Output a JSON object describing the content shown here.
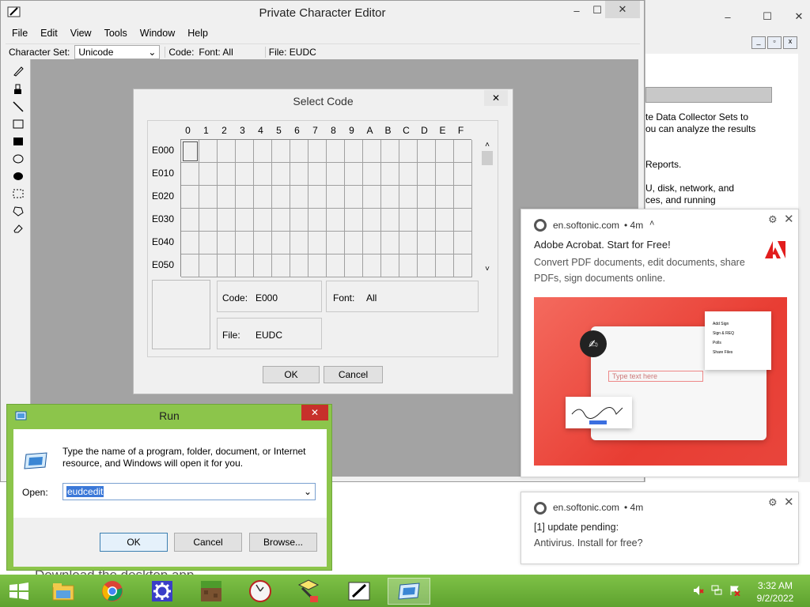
{
  "bg_window": {
    "lines": [
      "te Data Collector Sets to",
      "ou can analyze the results",
      "Reports.",
      "U, disk, network, and",
      "ces, and running"
    ],
    "behind_text": "Download the desktop app"
  },
  "pce": {
    "title": "Private Character Editor",
    "menus": [
      "File",
      "Edit",
      "View",
      "Tools",
      "Window",
      "Help"
    ],
    "charset_label": "Character Set:",
    "charset_value": "Unicode",
    "code_label": "Code:",
    "font_label": "Font: All",
    "file_label": "File: EUDC"
  },
  "select_code": {
    "title": "Select Code",
    "columns": [
      "0",
      "1",
      "2",
      "3",
      "4",
      "5",
      "6",
      "7",
      "8",
      "9",
      "A",
      "B",
      "C",
      "D",
      "E",
      "F"
    ],
    "rows": [
      "E000",
      "E010",
      "E020",
      "E030",
      "E040",
      "E050"
    ],
    "code_label": "Code:",
    "code_value": "E000",
    "font_label": "Font:",
    "font_value": "All",
    "file_label": "File:",
    "file_value": "EUDC",
    "ok": "OK",
    "cancel": "Cancel"
  },
  "run": {
    "title": "Run",
    "description": "Type the name of a program, folder, document, or Internet resource, and Windows will open it for you.",
    "open_label": "Open:",
    "open_value": "eudcedit",
    "ok": "OK",
    "cancel": "Cancel",
    "browse": "Browse..."
  },
  "notifications": [
    {
      "source": "en.softonic.com",
      "age": "• 4m",
      "title": "Adobe Acrobat. Start for Free!",
      "body": "Convert PDF documents, edit documents, share PDFs, sign documents online."
    },
    {
      "source": "en.softonic.com",
      "age": "• 4m",
      "title": "[1] update pending:",
      "body": "Antivirus. Install for free?"
    }
  ],
  "ad_image": {
    "placeholder_text": "Type text here",
    "menu": [
      "Add Sign",
      "Sign & REQ",
      "Polls",
      "Share Files"
    ]
  },
  "taskbar": {
    "time": "3:32 AM",
    "date": "9/2/2022"
  },
  "colors": {
    "taskbar": "#6fb23b",
    "run_frame": "#8cc54b",
    "canvas": "#a3a3a3",
    "ad_red": "#e8453c"
  }
}
